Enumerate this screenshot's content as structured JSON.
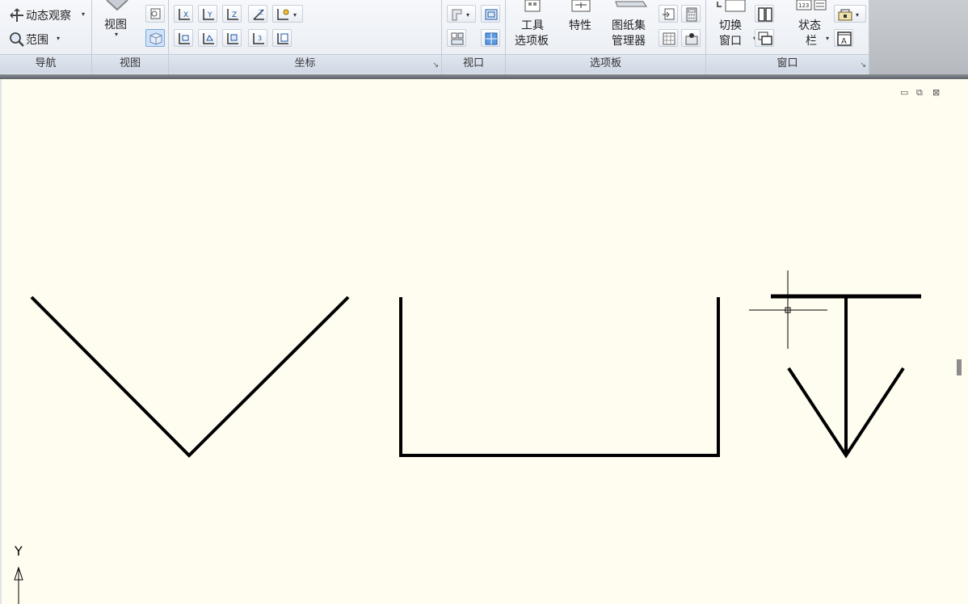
{
  "navigation": {
    "orbit_label": "动态观察",
    "extents_label": "范围",
    "title": "导航"
  },
  "view_panel": {
    "view_label": "视图",
    "title": "视图"
  },
  "coords_panel": {
    "title": "坐标"
  },
  "viewport_panel": {
    "title": "视口"
  },
  "palettes_panel": {
    "tool_palette_line1": "工具",
    "tool_palette_line2": "选项板",
    "properties_label": "特性",
    "sheetset_line1": "图纸集",
    "sheetset_line2": "管理器",
    "title": "选项板"
  },
  "window_panel": {
    "switch_line1": "切换",
    "switch_line2": "窗口",
    "statusbar_line1": "状态",
    "statusbar_line2": "栏",
    "title": "窗口"
  },
  "canvas": {
    "background": "#fffcf0",
    "ucs_y_label": "Y",
    "window_controls": [
      "minimize-icon",
      "restore-icon",
      "close-icon"
    ]
  },
  "colors": {
    "ribbon_bg": "#eef1f5",
    "panel_title_bg": "#d6dee9",
    "stroke": "#000000"
  }
}
